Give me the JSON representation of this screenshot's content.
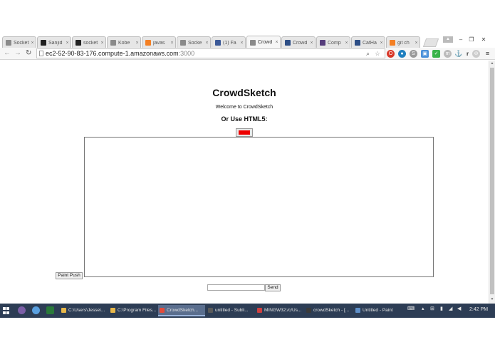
{
  "browser": {
    "tabs": [
      {
        "label": "Socket",
        "icon": "page-icon",
        "color": "#8a8a8a",
        "active": false
      },
      {
        "label": "Sanjid",
        "icon": "github-icon",
        "color": "#222222",
        "active": false
      },
      {
        "label": "socket",
        "icon": "github-icon",
        "color": "#222222",
        "active": false
      },
      {
        "label": "Kobe",
        "icon": "page-icon",
        "color": "#8a8a8a",
        "active": false
      },
      {
        "label": "javas",
        "icon": "stackoverflow-icon",
        "color": "#f48024",
        "active": false
      },
      {
        "label": "Socke",
        "icon": "page-icon",
        "color": "#8a8a8a",
        "active": false
      },
      {
        "label": "(1) Fa",
        "icon": "facebook-icon",
        "color": "#3b5998",
        "active": false
      },
      {
        "label": "Crowd",
        "icon": "page-icon",
        "color": "#8a8a8a",
        "active": true
      },
      {
        "label": "Crowd",
        "icon": "devpost-icon",
        "color": "#2d4e86",
        "active": false
      },
      {
        "label": "Comp",
        "icon": "bootstrap-icon",
        "color": "#563d7c",
        "active": false
      },
      {
        "label": "CatHa",
        "icon": "devpost-icon",
        "color": "#2d4e86",
        "active": false
      },
      {
        "label": "git ch",
        "icon": "stackoverflow-icon",
        "color": "#f48024",
        "active": false
      }
    ],
    "close_glyph": "×",
    "url_host": "ec2-52-90-83-176.compute-1.amazonaws.com",
    "url_port": ":3000"
  },
  "page": {
    "title": "CrowdSketch",
    "welcome": "Welcome to CrowdSketch",
    "subtitle": "Or Use HTML5:",
    "color_swatch": "#ee0000",
    "paint_push_label": "Paint Push",
    "message_value": "",
    "send_label": "Send"
  },
  "taskbar": {
    "tasks": [
      {
        "label": "C:\\Users\\Jesse\\...",
        "color": "#e8b84a",
        "active": false
      },
      {
        "label": "C:\\Program Files...",
        "color": "#e8b84a",
        "active": false
      },
      {
        "label": "CrowdSketch...",
        "color": "#e24b3b",
        "active": true
      },
      {
        "label": "untitled - Subli...",
        "color": "#5a5a5a",
        "active": false
      },
      {
        "label": "MINGW32:/c/Us...",
        "color": "#d04040",
        "active": false
      },
      {
        "label": "crowdSketch - [...",
        "color": "#3a3a3a",
        "active": false
      },
      {
        "label": "Untitled - Paint",
        "color": "#5f8fc8",
        "active": false
      }
    ],
    "time": "2:42 PM"
  }
}
